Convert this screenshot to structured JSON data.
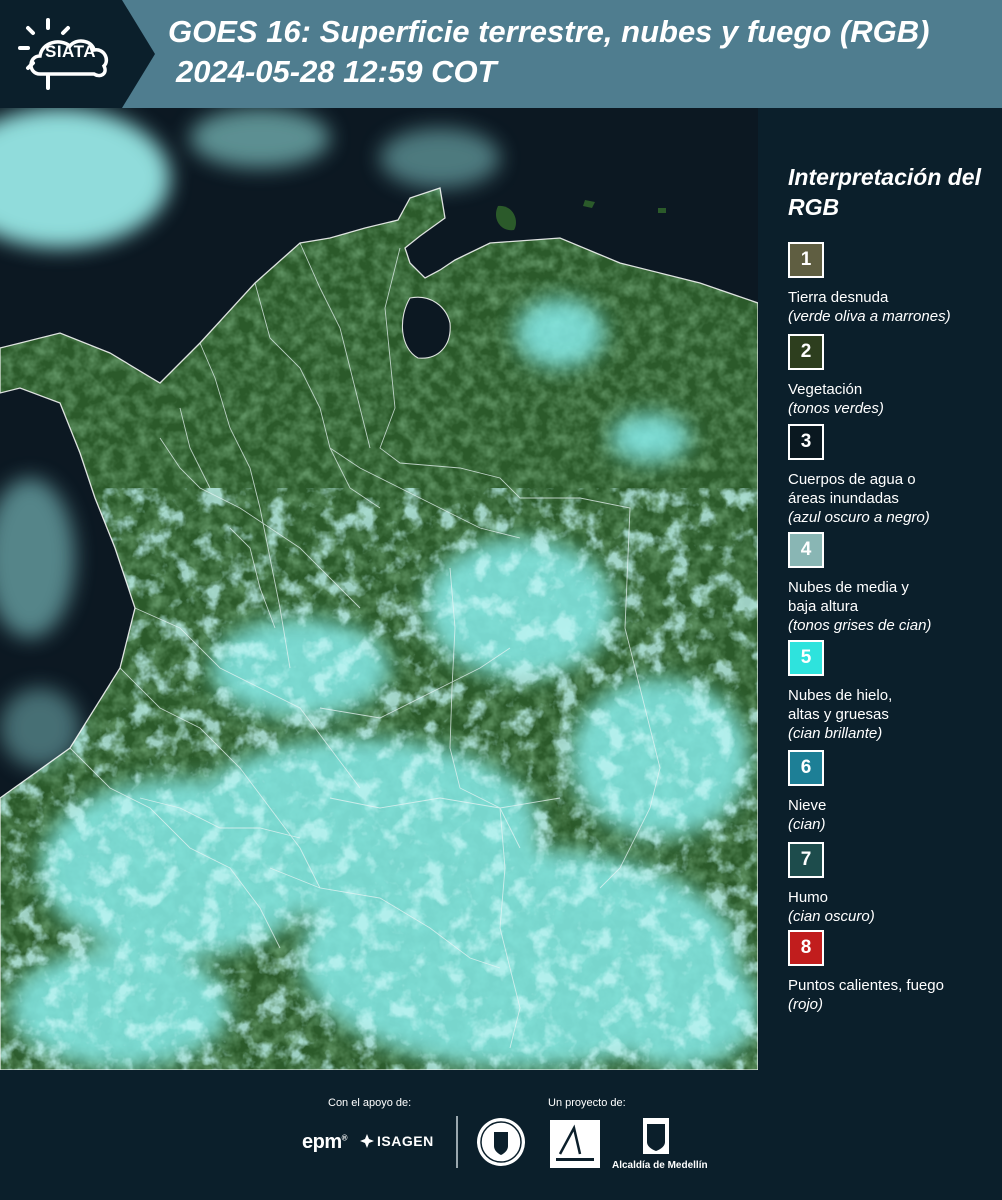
{
  "header": {
    "logo_text": "SIATA",
    "title_line1": "GOES 16: Superficie terrestre, nubes y fuego (RGB)",
    "title_line2": "2024-05-28 12:59 COT"
  },
  "legend": {
    "title": "Interpretación del RGB",
    "items": [
      {
        "number": "1",
        "label": "Tierra desnuda",
        "sub": "(verde oliva a marrones)",
        "color": "#5f5e41"
      },
      {
        "number": "2",
        "label": "Vegetación",
        "sub": "(tonos verdes)",
        "color": "#2d3e1e"
      },
      {
        "number": "3",
        "label": "Cuerpos de agua o áreas inundadas",
        "sub": "(azul oscuro a negro)",
        "color": "#0a1820"
      },
      {
        "number": "4",
        "label": "Nubes de media y baja altura",
        "sub": "(tonos grises de cian)",
        "color": "#89b6b4"
      },
      {
        "number": "5",
        "label": "Nubes de hielo, altas y gruesas",
        "sub": "(cian brillante)",
        "color": "#2ee3dd"
      },
      {
        "number": "6",
        "label": "Nieve",
        "sub": "(cian)",
        "color": "#1d7f96"
      },
      {
        "number": "7",
        "label": "Humo",
        "sub": "(cian oscuro)",
        "color": "#1d4c4c"
      },
      {
        "number": "8",
        "label": "Puntos calientes, fuego",
        "sub": "(rojo)",
        "color": "#c11d1d"
      }
    ]
  },
  "footer": {
    "support_label": "Con el apoyo de:",
    "project_label": "Un proyecto de:",
    "sponsors": [
      "epm",
      "ISAGEN"
    ],
    "medellin": "Alcaldía de Medellín"
  },
  "colors": {
    "header_bg": "#4f7d8f",
    "panel_bg": "#0b1f2b",
    "ocean": "#0c1822",
    "vegetation": "#2b5a2a",
    "cloud": "#7fe9e6"
  }
}
